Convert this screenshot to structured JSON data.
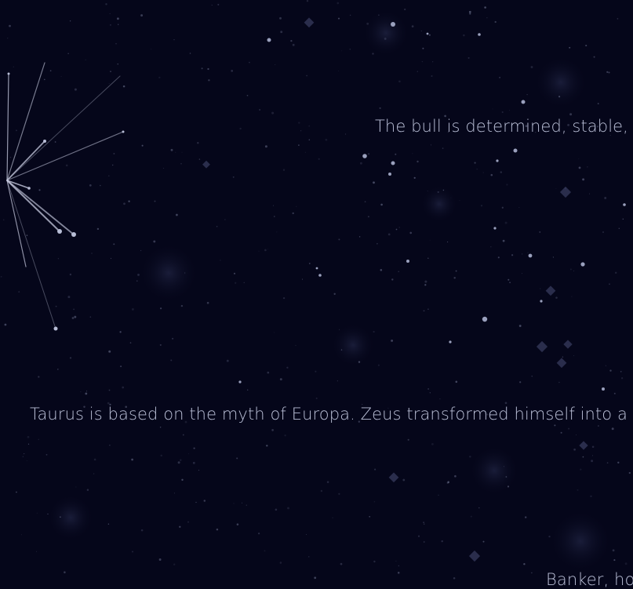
{
  "page": {
    "background_color": "#05061a",
    "text_color": "#c9cfe6",
    "constellation_line_color": "#c7cbe0"
  },
  "texts": {
    "traits": "The bull is determined, stable,",
    "myth": "Taurus is based on the myth of Europa. Zeus transformed himself into a",
    "careers": "Banker, ho"
  }
}
